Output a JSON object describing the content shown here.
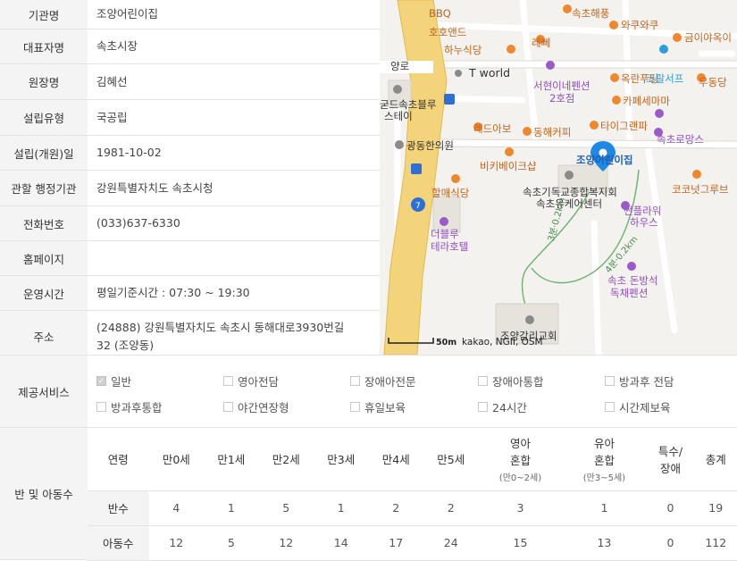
{
  "info_rows": [
    {
      "label": "기관명",
      "value": "조양어린이집"
    },
    {
      "label": "대표자명",
      "value": "속초시장"
    },
    {
      "label": "원장명",
      "value": "김혜선"
    },
    {
      "label": "설립유형",
      "value": "국공립"
    },
    {
      "label": "설립(개원)일",
      "value": "1981-10-02"
    },
    {
      "label": "관할 행정기관",
      "value": "강원특별자치도 속초시청"
    },
    {
      "label": "전화번호",
      "value": "(033)637-6330"
    },
    {
      "label": "홈페이지",
      "value": ""
    },
    {
      "label": "운영시간",
      "value": "평일기준시간 : 07:30 ~ 19:30"
    },
    {
      "label": "주소",
      "value_line1": "(24888) 강원특별자치도 속초시 동해대로3930번길",
      "value_line2": "32 (조양동)"
    }
  ],
  "map": {
    "labels": {
      "bbq": "BBQ",
      "sokchohaepung": "속초해풍",
      "wakuwaku": "와쿠와쿠",
      "geumiya": "금이야옥이",
      "hohoand": "호호앤드",
      "hanusikdang": "하누식당",
      "rebbe": "레뻬",
      "yangro": "양로",
      "tworld": "T world",
      "okranpuding": "옥란푸딩",
      "korasseop": "코랄서프",
      "udongdang": "우동당",
      "seohyeon": "서현이네펜션",
      "seohyeon2": "2호점",
      "stay1": "굳드속초블루",
      "stay2": "스테이",
      "cafesemama": "카페세마마",
      "redabo": "레드아보",
      "donghaecoffee": "동해커피",
      "tigerpaw": "타이그랜파",
      "sokchoromang": "속초로망스",
      "gwangdong": "광동한의원",
      "kidsname": "조양어린이집",
      "bikibake": "비키베이크샵",
      "coconut": "코코넛그루브",
      "church1": "속초기독교종합복지회",
      "church2": "속초유케어센터",
      "halmae": "할매식당",
      "sunflower1": "썬플라워",
      "sunflower2": "하우스",
      "route7": "7",
      "theblue1": "더블루",
      "theblue2": "테라호텔",
      "walk1": "3분·0.2km",
      "walk2": "4분·0.2km",
      "donbang1": "속초 돈방석",
      "donbang2": "독채펜션",
      "joyang_church": "조양감리교회",
      "scale": "50m",
      "copyright": "kakao, NGII, OSM"
    },
    "colors": {
      "road_main": "#f4d47a",
      "road_edge": "#e2b94a",
      "marker": "#1e88e5",
      "poi_orange": "#f0872c",
      "poi_purple": "#9b59c9",
      "poi_blue": "#2d9de0"
    }
  },
  "services": {
    "label": "제공서비스",
    "items": [
      {
        "label": "일반",
        "checked": true
      },
      {
        "label": "영아전담",
        "checked": false
      },
      {
        "label": "장애아전문",
        "checked": false
      },
      {
        "label": "장애아통합",
        "checked": false
      },
      {
        "label": "방과후 전담",
        "checked": false
      },
      {
        "label": "방과후통합",
        "checked": false
      },
      {
        "label": "야간연장형",
        "checked": false
      },
      {
        "label": "휴일보육",
        "checked": false
      },
      {
        "label": "24시간",
        "checked": false
      },
      {
        "label": "시간제보육",
        "checked": false
      }
    ]
  },
  "classes": {
    "label": "반 및 아동수",
    "header": [
      "연령",
      "만0세",
      "만1세",
      "만2세",
      "만3세",
      "만4세",
      "만5세",
      "영아|혼합",
      "유아|혼합",
      "특수/|장애",
      "총계"
    ],
    "header_sub": {
      "7": "(만0~2세)",
      "8": "(만3~5세)"
    },
    "rows": [
      {
        "label": "반수",
        "values": [
          "4",
          "1",
          "5",
          "1",
          "2",
          "2",
          "3",
          "1",
          "0",
          "19"
        ]
      },
      {
        "label": "아동수",
        "values": [
          "12",
          "5",
          "12",
          "14",
          "17",
          "24",
          "15",
          "13",
          "0",
          "112"
        ]
      }
    ]
  }
}
